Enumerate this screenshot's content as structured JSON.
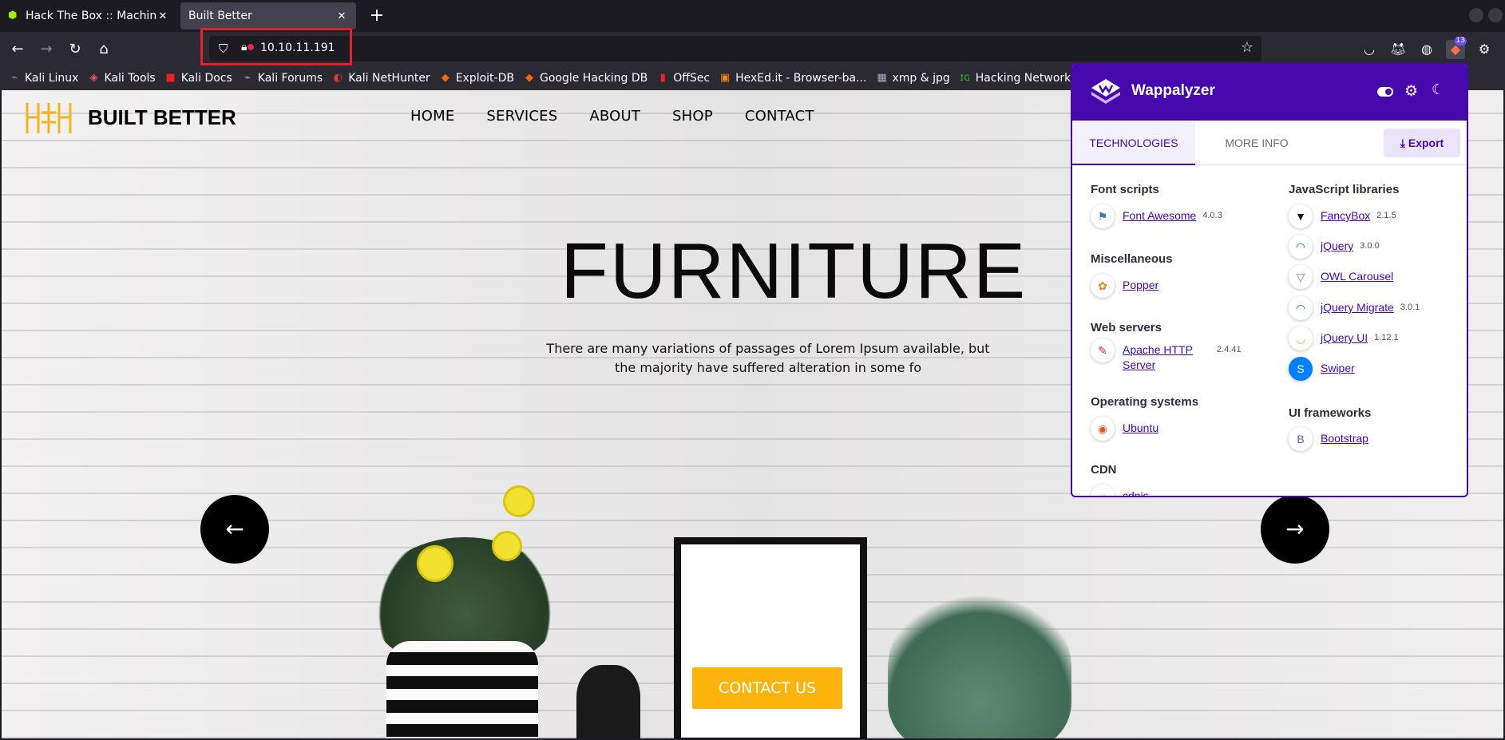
{
  "browser": {
    "tabs": [
      {
        "title": "Hack The Box :: Machines",
        "active": false
      },
      {
        "title": "Built Better",
        "active": true
      }
    ],
    "new_tab": "+",
    "url": "10.10.11.191",
    "bookmarks": [
      "Kali Linux",
      "Kali Tools",
      "Kali Docs",
      "Kali Forums",
      "Kali NetHunter",
      "Exploit-DB",
      "Google Hacking DB",
      "OffSec",
      "HexEd.it - Browser-ba...",
      "xmp & jpg",
      "Hacking Network Print..."
    ],
    "extension_badge": "13"
  },
  "site": {
    "brand": "BUILT BETTER",
    "nav": [
      "HOME",
      "SERVICES",
      "ABOUT",
      "SHOP",
      "CONTACT"
    ],
    "hero_title": "FURNITURE",
    "hero_text": "There are many variations of passages of Lorem Ipsum available, but the majority have suffered alteration in some fo",
    "prev": "←",
    "next": "→",
    "cta": "CONTACT US",
    "colors": {
      "accent": "#fbb40b",
      "text": "#000000"
    }
  },
  "wappalyzer": {
    "title": "Wappalyzer",
    "tabs": [
      "TECHNOLOGIES",
      "MORE INFO"
    ],
    "export": "Export",
    "color": "#4608ad",
    "left": [
      {
        "category": "Font scripts",
        "items": [
          {
            "name": "Font Awesome",
            "version": "4.0.3",
            "icon": "flag-icon"
          }
        ]
      },
      {
        "category": "Miscellaneous",
        "items": [
          {
            "name": "Popper",
            "version": "",
            "icon": "popper-icon"
          }
        ]
      },
      {
        "category": "Web servers",
        "items": [
          {
            "name": "Apache HTTP Server",
            "version": "2.4.41",
            "icon": "feather-icon"
          }
        ]
      },
      {
        "category": "Operating systems",
        "items": [
          {
            "name": "Ubuntu",
            "version": "",
            "icon": "ubuntu-icon"
          }
        ]
      },
      {
        "category": "CDN",
        "items": [
          {
            "name": "cdnjs",
            "version": "",
            "icon": "cdn-icon"
          }
        ]
      }
    ],
    "right": [
      {
        "category": "JavaScript libraries",
        "items": [
          {
            "name": "FancyBox",
            "version": "2.1.5",
            "icon": "fancybox-icon"
          },
          {
            "name": "jQuery",
            "version": "3.0.0",
            "icon": "jquery-icon"
          },
          {
            "name": "OWL Carousel",
            "version": "",
            "icon": "owl-icon"
          },
          {
            "name": "jQuery Migrate",
            "version": "3.0.1",
            "icon": "jquery-icon"
          },
          {
            "name": "jQuery UI",
            "version": "1.12.1",
            "icon": "jquery-ui-icon"
          },
          {
            "name": "Swiper",
            "version": "",
            "icon": "swiper-icon"
          }
        ]
      },
      {
        "category": "UI frameworks",
        "items": [
          {
            "name": "Bootstrap",
            "version": "",
            "icon": "bootstrap-icon"
          }
        ]
      }
    ]
  }
}
